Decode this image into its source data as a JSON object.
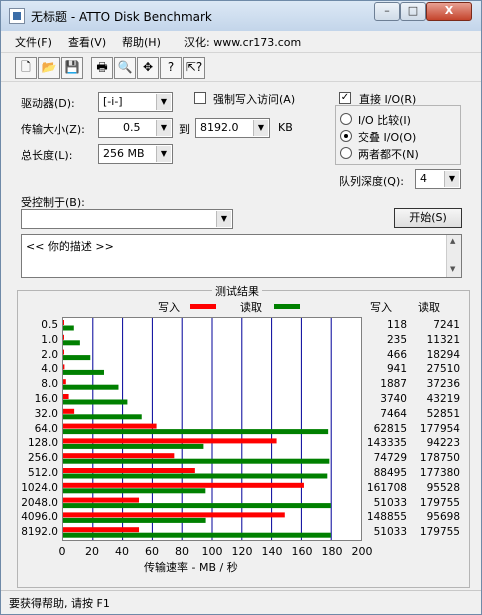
{
  "window": {
    "title": "无标题 - ATTO Disk Benchmark",
    "min_label": "–",
    "max_label": "□",
    "close_label": "X"
  },
  "menu": {
    "file": "文件(F)",
    "view": "查看(V)",
    "help": "帮助(H)",
    "localize": "汉化: www.cr173.com"
  },
  "toolbar": {
    "icons": [
      "new-file-icon",
      "open-folder-icon",
      "save-icon",
      "print-icon",
      "print-preview-icon",
      "move-icon",
      "help-icon",
      "context-help-icon"
    ]
  },
  "settings": {
    "drive_label": "驱动器(D):",
    "drive_value": "[-i-]",
    "transfer_label": "传输大小(Z):",
    "transfer_from": "0.5",
    "transfer_to_label": "到",
    "transfer_to": "8192.0",
    "transfer_unit": "KB",
    "length_label": "总长度(L):",
    "length_value": "256 MB",
    "force_write_label": "强制写入访问(A)",
    "force_write_checked": false,
    "direct_io_label": "直接 I/O(R)",
    "direct_io_checked": true,
    "io_compare_label": "I/O 比较(I)",
    "overlap_io_label": "交叠 I/O(O)",
    "neither_label": "两者都不(N)",
    "io_selected": "overlap",
    "queue_label": "队列深度(Q):",
    "queue_value": "4",
    "controlled_by_label": "受控制于(B):",
    "controlled_by_value": "",
    "start_label": "开始(S)",
    "description": "<< 你的描述 >>"
  },
  "results": {
    "title": "测试结果",
    "write_legend": "写入",
    "read_legend": "读取",
    "write_col": "写入",
    "read_col": "读取",
    "xlabel": "传输速率 - MB / 秒",
    "colors": {
      "write": "#ff0000",
      "read": "#008000",
      "grid": "#000099"
    }
  },
  "chart_data": {
    "type": "bar",
    "title": "测试结果",
    "xlabel": "传输速率 - MB / 秒",
    "xlim": [
      0,
      200
    ],
    "xticks": [
      "0",
      "20",
      "40",
      "60",
      "80",
      "100",
      "120",
      "140",
      "160",
      "180",
      "200"
    ],
    "categories": [
      "0.5",
      "1.0",
      "2.0",
      "4.0",
      "8.0",
      "16.0",
      "32.0",
      "64.0",
      "128.0",
      "256.0",
      "512.0",
      "1024.0",
      "2048.0",
      "4096.0",
      "8192.0"
    ],
    "series": [
      {
        "name": "写入",
        "values_kb": [
          "118",
          "235",
          "466",
          "941",
          "1887",
          "3740",
          "7464",
          "62815",
          "143335",
          "74729",
          "88495",
          "161708",
          "51033",
          "148855",
          "51033"
        ]
      },
      {
        "name": "读取",
        "values_kb": [
          "7241",
          "11321",
          "18294",
          "27510",
          "37236",
          "43219",
          "52851",
          "177954",
          "94223",
          "178750",
          "177380",
          "95528",
          "179755",
          "95698",
          "179755"
        ]
      }
    ]
  },
  "status": {
    "text": "要获得帮助, 请按 F1"
  }
}
